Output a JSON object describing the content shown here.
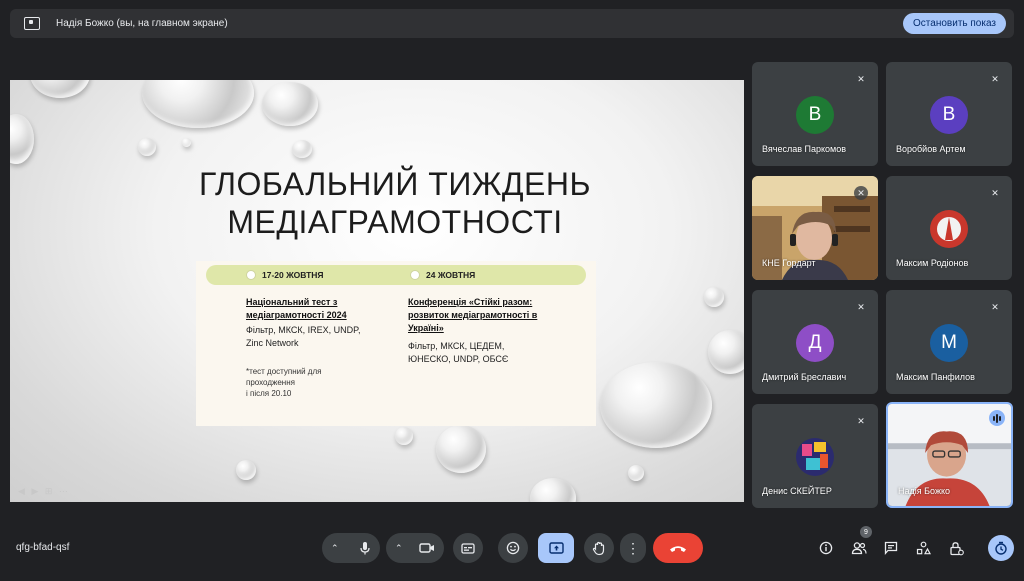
{
  "banner": {
    "text": "Надія Божко (вы, на главном экране)",
    "stop_label": "Остановить показ"
  },
  "slide": {
    "title_line1": "ГЛОБАЛЬНИЙ ТИЖДЕНЬ",
    "title_line2": "МЕДІАГРАМОТНОСТІ",
    "events": [
      {
        "date": "17-20 ЖОВТНЯ",
        "title_line1": "Національний тест з",
        "title_line2": "медіаграмотності 2024",
        "org_line1": "Фільтр, МКСК, IREX, UNDP,",
        "org_line2": "Zinc Network",
        "note_line1": "*тест доступний для",
        "note_line2": "проходження",
        "note_line3": "і після 20.10"
      },
      {
        "date": "24 ЖОВТНЯ",
        "title_line1": "Конференція «Стійкі разом:",
        "title_line2": "розвиток медіаграмотності в",
        "title_line3": "Україні»",
        "org_line1": "Фільтр, МКСК, ЦЕДЕМ,",
        "org_line2": "ЮНЕСКО, UNDP, ОБСЄ"
      }
    ]
  },
  "participants": [
    {
      "name": "Вячеслав Паркомов",
      "initial": "В",
      "color": "#1e7a34"
    },
    {
      "name": "Воробйов Артем",
      "initial": "В",
      "color": "#5b3fc0"
    },
    {
      "name": "КНЕ Гордарт",
      "initial": "",
      "color": ""
    },
    {
      "name": "Максим Родіонов",
      "initial": "",
      "color": ""
    },
    {
      "name": "Дмитрий Бреславич",
      "initial": "Д",
      "color": "#8e4ec6"
    },
    {
      "name": "Максим Панфилов",
      "initial": "М",
      "color": "#1a5fa0"
    },
    {
      "name": "Денис СКЕЙТЕР",
      "initial": "",
      "color": ""
    },
    {
      "name": "Надія Божко",
      "initial": "",
      "color": ""
    }
  ],
  "bottom": {
    "meeting_code": "qfg-bfad-qsf",
    "participants_count": "9"
  },
  "icons": {
    "mic": "mic-icon",
    "camera": "camera-icon",
    "captions": "captions-icon",
    "emoji": "emoji-icon",
    "present": "present-icon",
    "hand": "raise-hand-icon",
    "more": "more-icon",
    "leave": "leave-call-icon"
  }
}
